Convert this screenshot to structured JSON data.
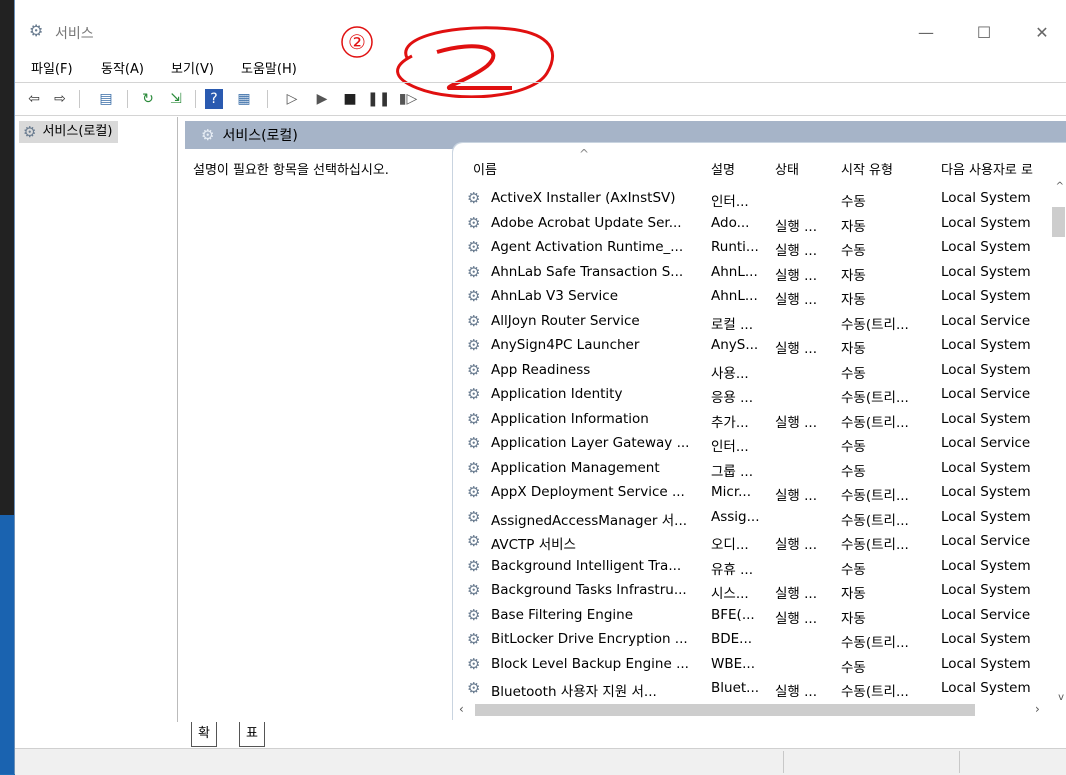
{
  "window": {
    "title": "서비스",
    "controls": {
      "minimize": "—",
      "maximize": "☐",
      "close": "✕"
    }
  },
  "annotation": {
    "circled_number": "②",
    "handwritten": "2",
    "color": "#e01010"
  },
  "menu": [
    "파일(F)",
    "동작(A)",
    "보기(V)",
    "도움말(H)"
  ],
  "toolbar": {
    "icons": [
      "back-icon",
      "forward-icon",
      "show-tree-icon",
      "refresh-icon",
      "export-icon",
      "help-icon",
      "properties-icon",
      "start-icon",
      "start-alt-icon",
      "stop-icon",
      "pause-icon",
      "restart-icon"
    ]
  },
  "tree": {
    "root_label": "서비스(로컬)"
  },
  "content": {
    "header": "서비스(로컬)",
    "description": "설명이 필요한 항목을 선택하십시오."
  },
  "columns": [
    "이름",
    "설명",
    "상태",
    "시작 유형",
    "다음 사용자로 로"
  ],
  "services": [
    {
      "name": "ActiveX Installer (AxInstSV)",
      "desc": "인터...",
      "status": "",
      "startup": "수동",
      "logon": "Local System"
    },
    {
      "name": "Adobe Acrobat Update Ser...",
      "desc": "Ado...",
      "status": "실행 ...",
      "startup": "자동",
      "logon": "Local System"
    },
    {
      "name": "Agent Activation Runtime_...",
      "desc": "Runti...",
      "status": "실행 ...",
      "startup": "수동",
      "logon": "Local System"
    },
    {
      "name": "AhnLab Safe Transaction S...",
      "desc": "AhnL...",
      "status": "실행 ...",
      "startup": "자동",
      "logon": "Local System"
    },
    {
      "name": "AhnLab V3 Service",
      "desc": "AhnL...",
      "status": "실행 ...",
      "startup": "자동",
      "logon": "Local System"
    },
    {
      "name": "AllJoyn Router Service",
      "desc": "로컬 ...",
      "status": "",
      "startup": "수동(트리...",
      "logon": "Local Service"
    },
    {
      "name": "AnySign4PC Launcher",
      "desc": "AnyS...",
      "status": "실행 ...",
      "startup": "자동",
      "logon": "Local System"
    },
    {
      "name": "App Readiness",
      "desc": "사용...",
      "status": "",
      "startup": "수동",
      "logon": "Local System"
    },
    {
      "name": "Application Identity",
      "desc": "응용 ...",
      "status": "",
      "startup": "수동(트리...",
      "logon": "Local Service"
    },
    {
      "name": "Application Information",
      "desc": "추가...",
      "status": "실행 ...",
      "startup": "수동(트리...",
      "logon": "Local System"
    },
    {
      "name": "Application Layer Gateway ...",
      "desc": "인터...",
      "status": "",
      "startup": "수동",
      "logon": "Local Service"
    },
    {
      "name": "Application Management",
      "desc": "그룹 ...",
      "status": "",
      "startup": "수동",
      "logon": "Local System"
    },
    {
      "name": "AppX Deployment Service ...",
      "desc": "Micr...",
      "status": "실행 ...",
      "startup": "수동(트리...",
      "logon": "Local System"
    },
    {
      "name": "AssignedAccessManager 서...",
      "desc": "Assig...",
      "status": "",
      "startup": "수동(트리...",
      "logon": "Local System"
    },
    {
      "name": "AVCTP 서비스",
      "desc": "오디...",
      "status": "실행 ...",
      "startup": "수동(트리...",
      "logon": "Local Service"
    },
    {
      "name": "Background Intelligent Tra...",
      "desc": "유휴 ...",
      "status": "",
      "startup": "수동",
      "logon": "Local System"
    },
    {
      "name": "Background Tasks Infrastru...",
      "desc": "시스...",
      "status": "실행 ...",
      "startup": "자동",
      "logon": "Local System"
    },
    {
      "name": "Base Filtering Engine",
      "desc": "BFE(...",
      "status": "실행 ...",
      "startup": "자동",
      "logon": "Local Service"
    },
    {
      "name": "BitLocker Drive Encryption ...",
      "desc": "BDE...",
      "status": "",
      "startup": "수동(트리...",
      "logon": "Local System"
    },
    {
      "name": "Block Level Backup Engine ...",
      "desc": "WBE...",
      "status": "",
      "startup": "수동",
      "logon": "Local System"
    },
    {
      "name": "Bluetooth 사용자 지원 서...",
      "desc": "Bluet...",
      "status": "실행 ...",
      "startup": "수동(트리...",
      "logon": "Local System"
    }
  ],
  "tabs": [
    "확장",
    "표준"
  ]
}
